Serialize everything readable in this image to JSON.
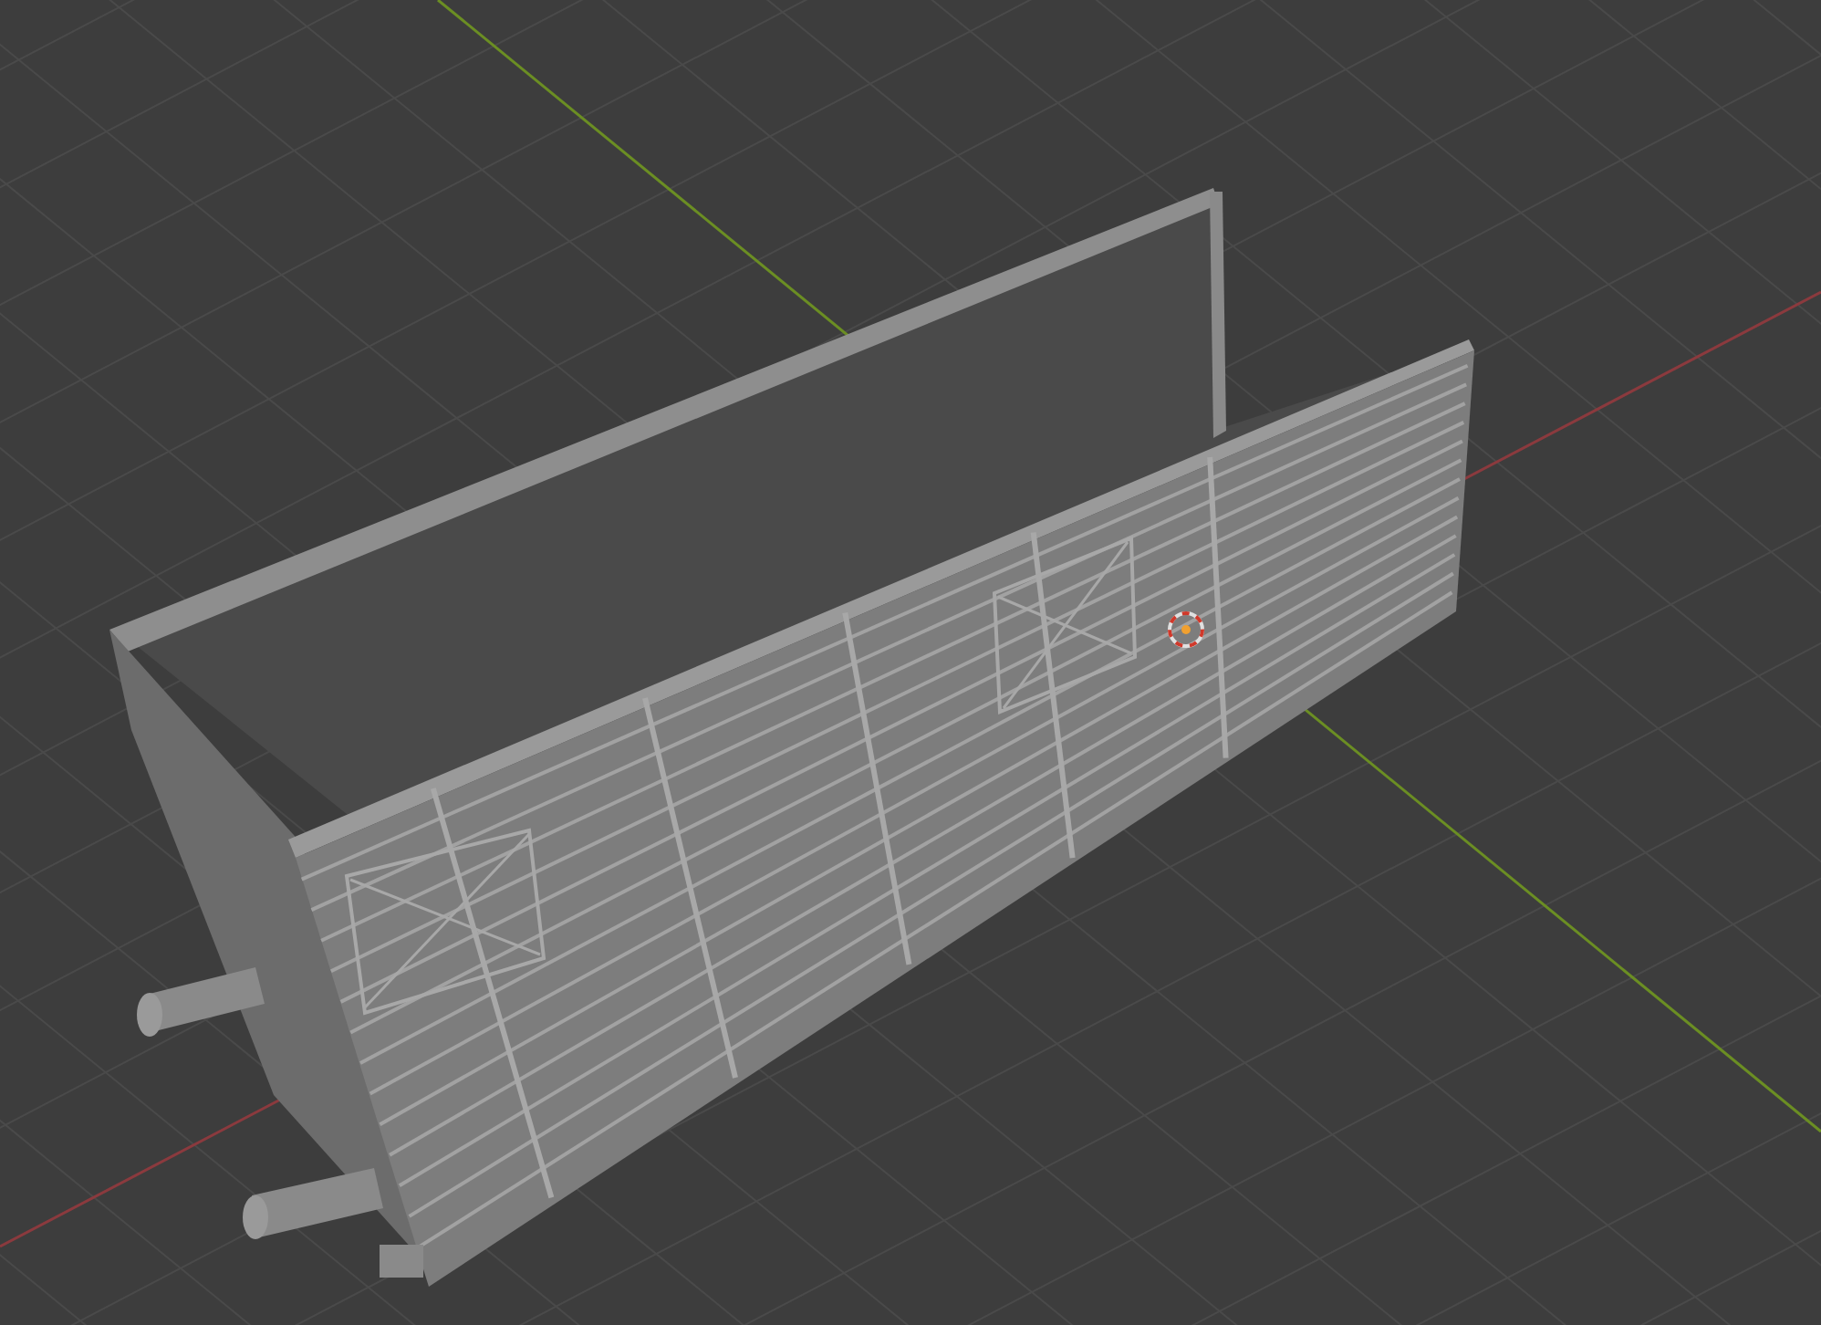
{
  "viewport": {
    "kind": "viewport",
    "cursor_visible": true
  }
}
